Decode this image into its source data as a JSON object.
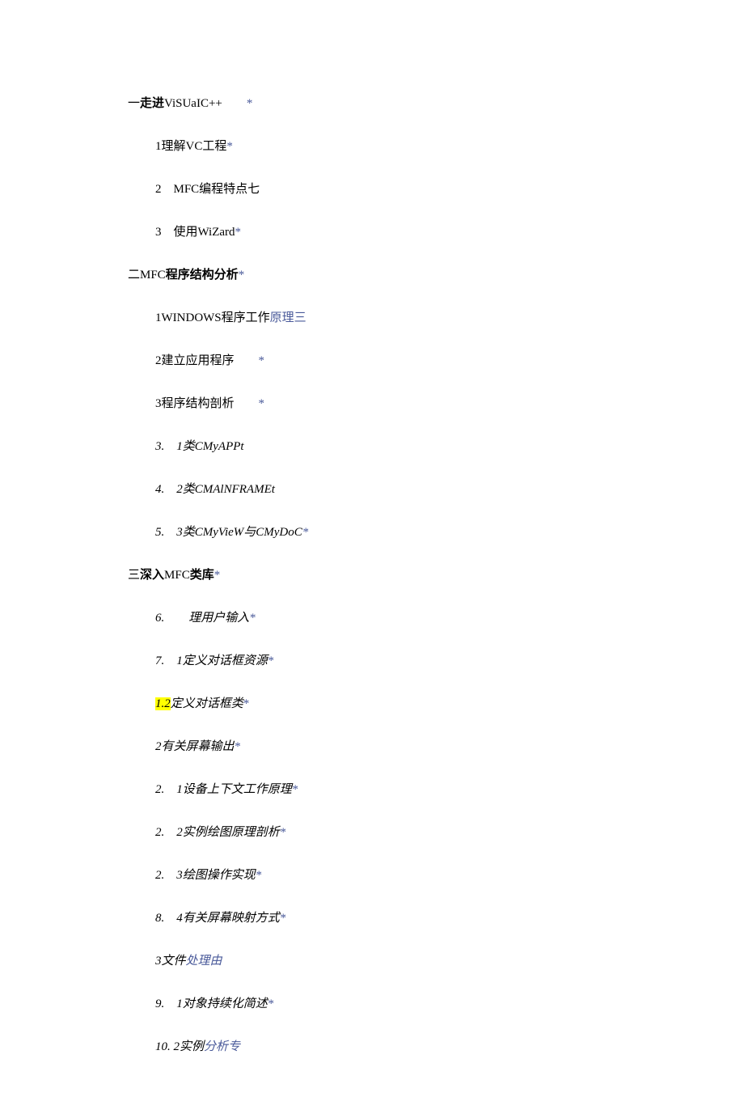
{
  "lines": {
    "l1_pre": "一",
    "l1_bold": "走进",
    "l1_text": "ViSUaIC++",
    "l1_star": "*",
    "l2_text": "1理解VC工程",
    "l2_star": "*",
    "l3_text": "2　MFC编程特点七",
    "l4_text": "3　使用WiZard",
    "l4_star": "*",
    "l5_pre": "二MFC",
    "l5_bold": "程序结构分析",
    "l5_star": "*",
    "l6_text": "1WINDOWS程序工作",
    "l6_link": "原理三",
    "l7_text": "2建立应用程序",
    "l7_star": "*",
    "l8_text": "3程序结构剖析",
    "l8_star": "*",
    "l9_text": "3.　1类CMyAPPt",
    "l10_text": "4.　2类CMAlNFRAMEt",
    "l11_text": "5.　3类CMyVieW与CMyDoC",
    "l11_star": "*",
    "l12_pre": "三",
    "l12_bold": "深入",
    "l12_text": "MFC",
    "l12_bold2": "类库",
    "l12_star": "*",
    "l13_text": "6.　　理用户输入",
    "l13_star": "*",
    "l14_text": "7.　1定义对话框资源",
    "l14_star": "*",
    "l15_hl": "1.2",
    "l15_text": "定义对话框类",
    "l15_star": "*",
    "l16_text": "2有关屏幕输出",
    "l16_star": "*",
    "l17_text": "2.　1设备上下文工作原理",
    "l17_star": "*",
    "l18_text": "2.　2实例绘图原理剖析",
    "l18_star": "*",
    "l19_text": "2.　3绘图操作实现",
    "l19_star": "*",
    "l20_text": "8.　4有关屏幕映射方式",
    "l20_star": "*",
    "l21_text": "3文件",
    "l21_link": "处理由",
    "l22_text": "9.　1对象持续化简述",
    "l22_star": "*",
    "l23_text": "10. 2实例",
    "l23_link": "分析专"
  }
}
